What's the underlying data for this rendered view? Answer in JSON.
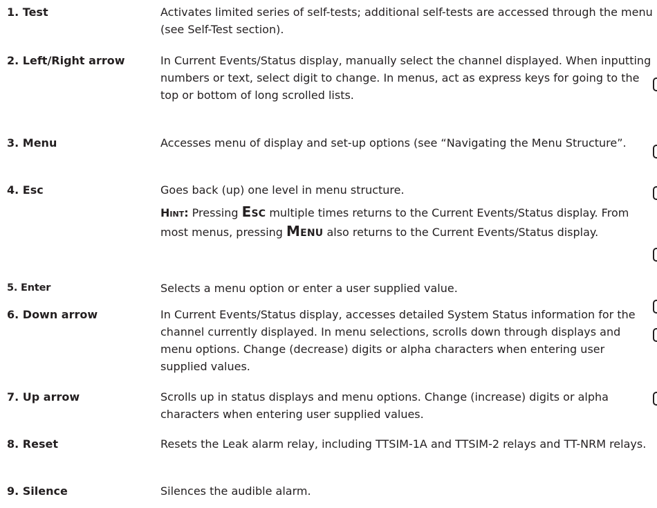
{
  "items": [
    {
      "term": "1. Test",
      "desc": "Activates limited series of self-tests; additional self-tests are accessed through the menu (see Self-Test section)."
    },
    {
      "term": "2. Left/Right arrow",
      "desc": "In Current Events/Status display, manually select the channel displayed. When inputting numbers or text, select digit to change. In menus, act as express keys for going to the top or bottom of long scrolled lists."
    },
    {
      "term": "3. Menu",
      "desc": "Accesses menu of display and set-up options (see “Navigating the Menu Structure”."
    },
    {
      "term": "4. Esc",
      "desc": "Goes back (up) one level in menu structure.",
      "hint": {
        "label": "Hint:",
        "part1": " Pressing ",
        "key1": "Esc",
        "part2": " multiple times returns to the Current Events/Status display. From most menus, pressing ",
        "key2": "Menu",
        "part3": " also returns to the Current Events/Status display."
      }
    },
    {
      "term": "5. Enter",
      "desc": "Selects a menu option or enter a user supplied value."
    },
    {
      "term": "6. Down arrow",
      "desc": "In Current Events/Status display, accesses detailed System Status information for the channel currently displayed. In menu selections, scrolls down through displays and menu options. Change (decrease) digits or alpha characters when entering user supplied values."
    },
    {
      "term": "7. Up arrow",
      "desc": "Scrolls up in status displays and menu options. Change (increase) digits or alpha characters when entering user supplied values."
    },
    {
      "term": "8. Reset",
      "desc": "Resets the Leak alarm relay, including TTSIM-1A and TTSIM-2 relays and TT-NRM relays."
    },
    {
      "term": "9. Silence",
      "desc": "Silences the audible alarm."
    }
  ]
}
